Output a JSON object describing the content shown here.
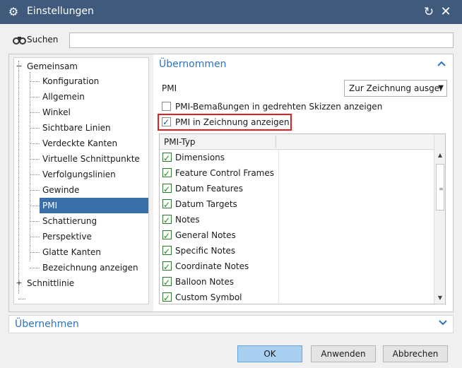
{
  "window": {
    "title": "Einstellungen",
    "icon": "gear-icon"
  },
  "search": {
    "label": "Suchen",
    "value": "",
    "placeholder": ""
  },
  "tree": {
    "items": [
      {
        "label": "Gemeinsam",
        "expander": "−"
      },
      {
        "label": "Konfiguration"
      },
      {
        "label": "Allgemein"
      },
      {
        "label": "Winkel"
      },
      {
        "label": "Sichtbare Linien"
      },
      {
        "label": "Verdeckte Kanten"
      },
      {
        "label": "Virtuelle Schnittpunkte"
      },
      {
        "label": "Verfolgungslinien"
      },
      {
        "label": "Gewinde"
      },
      {
        "label": "PMI",
        "selected": true
      },
      {
        "label": "Schattierung"
      },
      {
        "label": "Perspektive"
      },
      {
        "label": "Glatte Kanten"
      },
      {
        "label": "Bezeichnung anzeigen"
      },
      {
        "label": "Schnitt",
        "expander": "+"
      },
      {
        "label": "Schnittlinie"
      }
    ]
  },
  "section_inherited": {
    "title": "Übernommen",
    "pmi_label": "PMI",
    "pmi_select_value": "Zur Zeichnung ausger",
    "checkbox_rotated": {
      "label": "PMI-Bemaßungen in gedrehten Skizzen anzeigen",
      "checked": false
    },
    "checkbox_show": {
      "label": "PMI in Zeichnung anzeigen",
      "checked": true
    },
    "list": {
      "header": "PMI-Typ",
      "rows": [
        "Dimensions",
        "Feature Control Frames",
        "Datum Features",
        "Datum Targets",
        "Notes",
        "General Notes",
        "Specific Notes",
        "Coordinate Notes",
        "Balloon Notes",
        "Custom Symbol"
      ]
    }
  },
  "section_apply": {
    "title": "Übernehmen"
  },
  "buttons": {
    "ok": "OK",
    "apply": "Anwenden",
    "cancel": "Abbrechen"
  },
  "colors": {
    "titlebar": "#3f5a7a",
    "accent": "#2a74c4",
    "selection": "#3a6ea8",
    "highlight": "#e02020"
  }
}
